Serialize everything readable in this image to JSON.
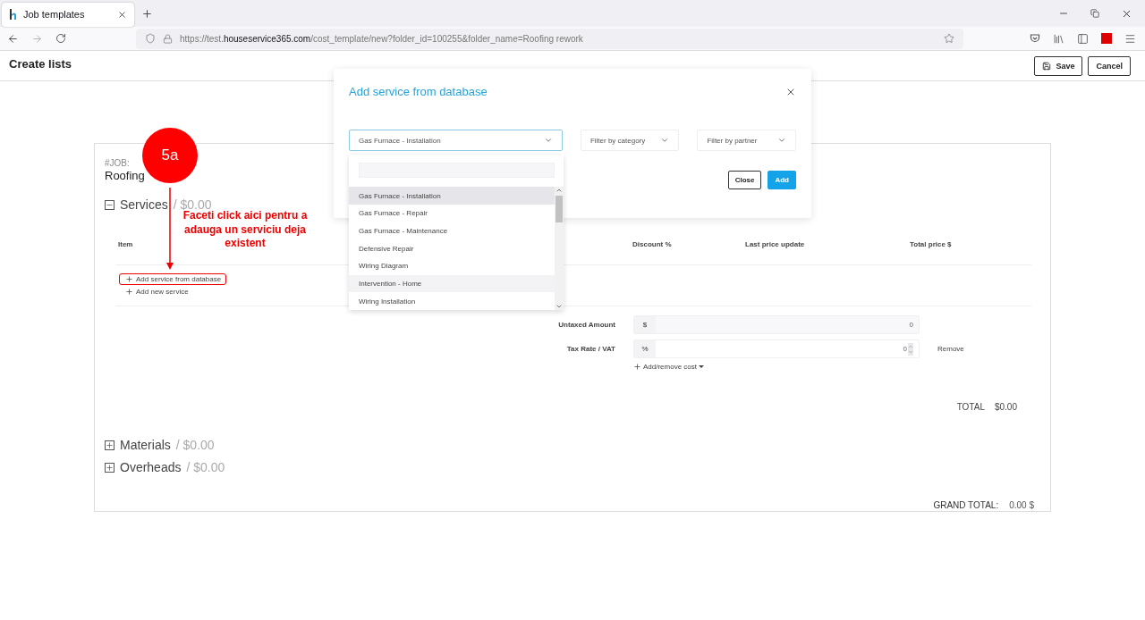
{
  "browser": {
    "tabs": [
      {
        "title": "Job templates",
        "selected": true
      }
    ],
    "url_prefix": "https://test.",
    "url_host": "houseservice365.com",
    "url_rest": "/cost_template/new?folder_id=100255&folder_name=Roofing rework"
  },
  "header": {
    "title": "Create lists",
    "buttons": [
      {
        "kind": "save",
        "label": "Save"
      },
      {
        "kind": "plain",
        "label": "Cancel"
      }
    ]
  },
  "job": {
    "label": "#JOB:",
    "title": "Roofing"
  },
  "sections": [
    {
      "name": "Services",
      "amount": "/ $0.00",
      "expanded": true
    },
    {
      "name": "Materials",
      "amount": "/ $0.00",
      "expanded": false
    },
    {
      "name": "Overheads",
      "amount": "/ $0.00",
      "expanded": false
    }
  ],
  "table": {
    "columns": [
      "Item",
      "Discount %",
      "Last price update",
      "Total price $"
    ],
    "links": [
      "Add service from database",
      "Add new service"
    ]
  },
  "costs": [
    {
      "label": "Untaxed Amount",
      "unit": "$",
      "value": "0",
      "kind": "plain"
    },
    {
      "label": "Tax Rate / VAT",
      "unit": "%",
      "value": "0",
      "kind": "spinner",
      "action": "Remove"
    }
  ],
  "add_cost": "Add/remove cost",
  "total": {
    "label": "TOTAL",
    "value": "$0.00"
  },
  "grand_total": {
    "label": "GRAND TOTAL:",
    "value": "0.00 $"
  },
  "modal": {
    "title": "Add service from database",
    "selects": [
      {
        "value": "Gas Furnace - Installation",
        "open": true
      },
      {
        "placeholder": "Filter by category",
        "open": false
      },
      {
        "placeholder": "Filter by partner",
        "open": false
      }
    ],
    "buttons": [
      {
        "kind": "outline",
        "label": "Close"
      },
      {
        "kind": "primary",
        "label": "Add"
      }
    ]
  },
  "dropdown": {
    "items": [
      {
        "label": "Gas Furnace - Installation",
        "selected": true,
        "hovered": false
      },
      {
        "label": "Gas Furnace - Repair",
        "selected": false,
        "hovered": false
      },
      {
        "label": "Gas Furnace - Maintenance",
        "selected": false,
        "hovered": false
      },
      {
        "label": "Defensive Repair",
        "selected": false,
        "hovered": false
      },
      {
        "label": "Wiring Diagram",
        "selected": false,
        "hovered": false
      },
      {
        "label": "Intervention - Home",
        "selected": false,
        "hovered": true
      },
      {
        "label": "Wiring Installation",
        "selected": false,
        "hovered": false
      }
    ]
  },
  "annotation": {
    "step": "5a",
    "note": "Faceti click aici pentru a adauga un serviciu deja existent"
  }
}
